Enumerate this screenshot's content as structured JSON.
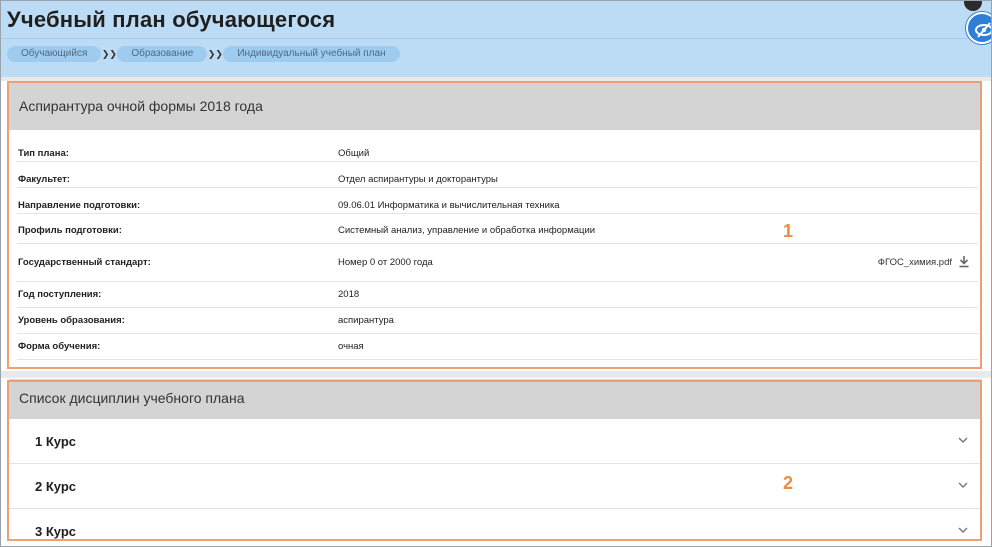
{
  "page": {
    "title": "Учебный план обучающегося"
  },
  "breadcrumb": [
    {
      "label": "Обучающийся"
    },
    {
      "label": "Образование"
    },
    {
      "label": "Индивидуальный учебный план"
    }
  ],
  "plan": {
    "heading": "Аспирантура очной формы 2018 года",
    "rows": [
      {
        "label": "Тип плана:",
        "value": "Общий"
      },
      {
        "label": "Факультет:",
        "value": "Отдел аспирантуры и докторантуры"
      },
      {
        "label": "Направление подготовки:",
        "value": "09.06.01 Информатика и вычислительная техника"
      },
      {
        "label": "Профиль подготовки:",
        "value": "Системный анализ, управление и обработка информации"
      },
      {
        "label": "Государственный стандарт:",
        "value": "Номер 0 от 2000 года",
        "file": "ФГОС_химия.pdf"
      },
      {
        "label": "Год поступления:",
        "value": "2018"
      },
      {
        "label": "Уровень образования:",
        "value": "аспирантура"
      },
      {
        "label": "Форма обучения:",
        "value": "очная"
      }
    ]
  },
  "disciplines": {
    "heading": "Список дисциплин учебного плана",
    "courses": [
      {
        "label": "1 Курс"
      },
      {
        "label": "2 Курс"
      },
      {
        "label": "3 Курс"
      }
    ]
  },
  "annotations": {
    "box1": "1",
    "box2": "2"
  },
  "colors": {
    "header_bg": "#bcdcf5",
    "crumb_bg": "#9fcbee",
    "section_head_bg": "#d4d4d4",
    "annotation_orange": "#f08a3c",
    "accent_blue": "#2f7fd6"
  },
  "icons": [
    "chevron-right-icon",
    "eye-slash-icon",
    "download-icon",
    "chevron-down-icon"
  ]
}
